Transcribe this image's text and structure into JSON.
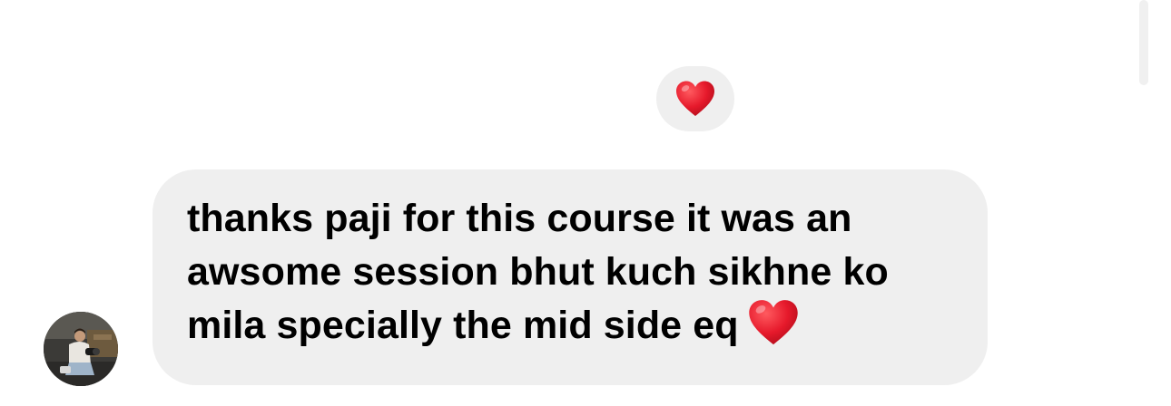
{
  "thread": {
    "reaction": {
      "emoji_icon": "red-heart-icon",
      "background_color": "#efefef"
    },
    "message": {
      "lines": [
        "thanks paji for this course it was an",
        "awsome session bhut kuch sikhne ko",
        "mila specially the mid side eq"
      ],
      "trailing_emoji_icon": "red-heart-icon",
      "bubble_color": "#efefef",
      "text_color": "#000000"
    },
    "sender": {
      "avatar_icon": "profile-photo"
    }
  },
  "colors": {
    "heart": "#e6192b",
    "background": "#ffffff",
    "scrollbar": "#f0f0f0"
  }
}
